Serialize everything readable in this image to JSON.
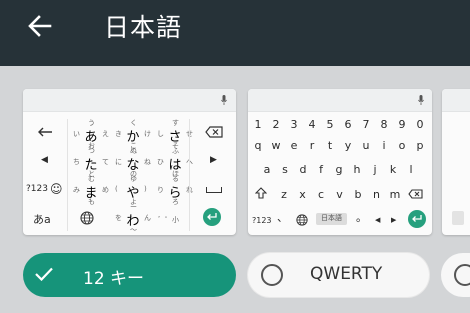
{
  "appbar": {
    "title": "日本語"
  },
  "layouts": {
    "twelve_key": {
      "rows": [
        {
          "left": "",
          "mid": [
            {
              "main": "あ",
              "t": "う",
              "b": "お",
              "l": "い",
              "r": "え"
            },
            {
              "main": "か",
              "t": "く",
              "b": "こ",
              "l": "き",
              "r": "け"
            },
            {
              "main": "さ",
              "t": "す",
              "b": "そ",
              "l": "し",
              "r": "せ"
            }
          ]
        },
        {
          "left": "",
          "mid": [
            {
              "main": "た",
              "t": "つ",
              "b": "と",
              "l": "ち",
              "r": "て"
            },
            {
              "main": "な",
              "t": "ぬ",
              "b": "の",
              "l": "に",
              "r": "ね"
            },
            {
              "main": "は",
              "t": "ふ",
              "b": "ほ",
              "l": "ひ",
              "r": "へ"
            }
          ]
        },
        {
          "left": "?123",
          "mid": [
            {
              "main": "ま",
              "t": "む",
              "b": "も",
              "l": "み",
              "r": "め"
            },
            {
              "main": "や",
              "t": "ゆ",
              "b": "よ",
              "l": "(",
              "r": ")"
            },
            {
              "main": "ら",
              "t": "る",
              "b": "ろ",
              "l": "り",
              "r": "れ"
            }
          ]
        },
        {
          "left": "あa",
          "mid": [
            {
              "main": "",
              "t": "",
              "b": "",
              "l": "",
              "r": ""
            },
            {
              "main": "わ",
              "t": "ー",
              "b": "〜",
              "l": "を",
              "r": "ん"
            },
            {
              "main": "",
              "t": "",
              "b": "",
              "l": "",
              "r": ""
            }
          ]
        }
      ],
      "bottom_small": "゛゜小"
    },
    "qwerty": {
      "numbers": [
        "1",
        "2",
        "3",
        "4",
        "5",
        "6",
        "7",
        "8",
        "9",
        "0"
      ],
      "row1": [
        "q",
        "w",
        "e",
        "r",
        "t",
        "y",
        "u",
        "i",
        "o",
        "p"
      ],
      "row2": [
        "a",
        "s",
        "d",
        "f",
        "g",
        "h",
        "j",
        "k",
        "l"
      ],
      "row3": [
        "z",
        "x",
        "c",
        "v",
        "b",
        "n",
        "m"
      ],
      "bottom": {
        "sym": "?123",
        "comma": "、",
        "lang": "日本語",
        "period": "。"
      }
    }
  },
  "options": {
    "twelve_key": {
      "label": "12 キー",
      "selected": true
    },
    "qwerty": {
      "label": "QWERTY",
      "selected": false
    }
  },
  "colors": {
    "appbar": "#263238",
    "accent": "#16947a",
    "background": "#d3d5d7"
  }
}
